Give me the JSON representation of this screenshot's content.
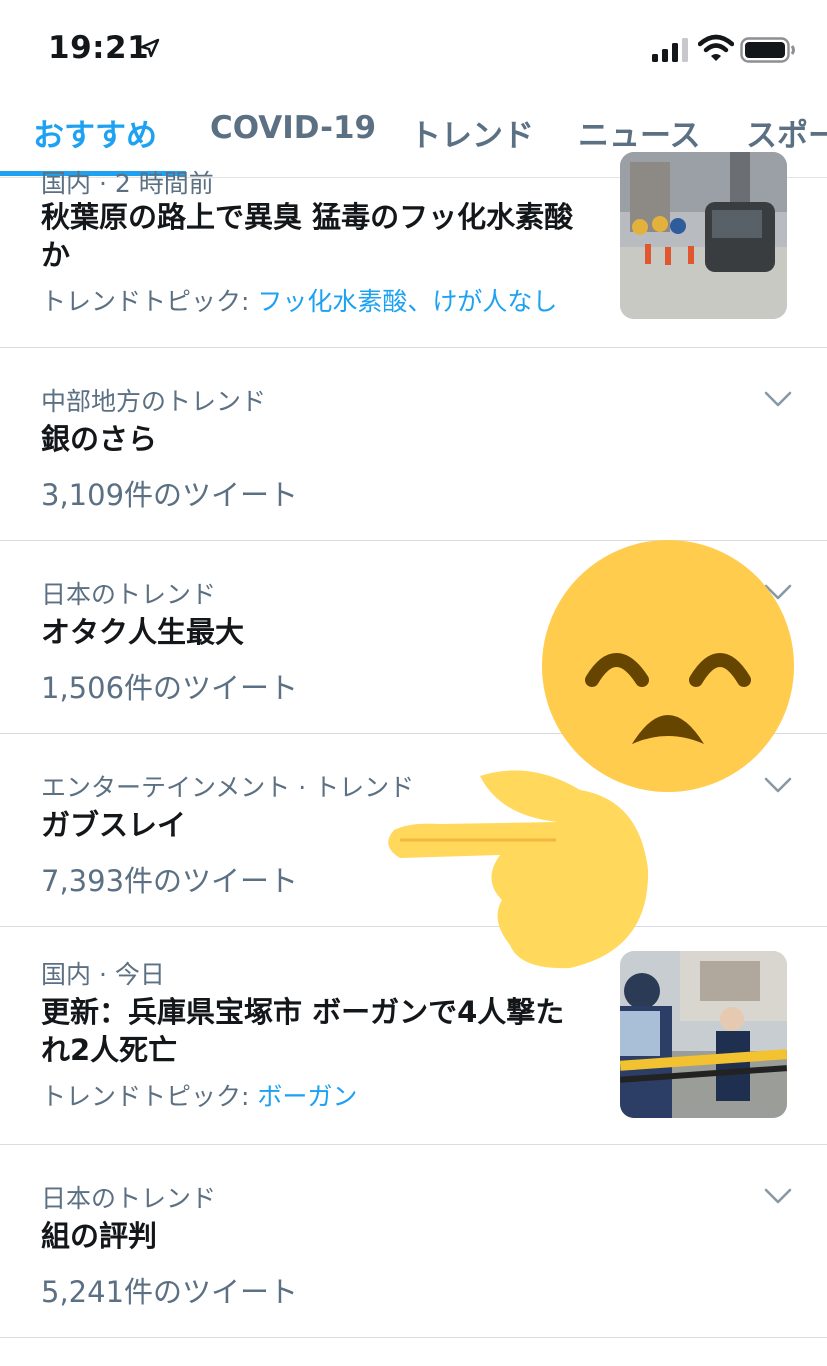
{
  "status_bar": {
    "time": "19:21",
    "icons": [
      "location-arrow-icon",
      "cellular-signal-icon",
      "wifi-icon",
      "battery-icon"
    ]
  },
  "tabs": [
    {
      "label": "おすすめ",
      "active": true
    },
    {
      "label": "COVID-19",
      "active": false
    },
    {
      "label": "トレンド",
      "active": false
    },
    {
      "label": "ニュース",
      "active": false
    },
    {
      "label": "スポー",
      "active": false
    }
  ],
  "colors": {
    "accent": "#1da1f2",
    "secondary_text": "#5b7083",
    "primary_text": "#14171a",
    "divider": "#d7dde2",
    "emoji_yellow": "#ffcc4d"
  },
  "items": [
    {
      "meta": "国内 · 2 時間前",
      "title_line1": "秋葉原の路上で異臭 猛毒のフッ化水素酸",
      "title_line2": "か",
      "topic_prefix": "トレンドトピック: ",
      "topic_links": "フッ化水素酸、けが人なし",
      "has_thumbnail": true
    },
    {
      "meta": "中部地方のトレンド",
      "title": "銀のさら",
      "count": "3,109件のツイート"
    },
    {
      "meta": "日本のトレンド",
      "title": "オタク人生最大",
      "count": "1,506件のツイート"
    },
    {
      "meta": "エンターテインメント · トレンド",
      "title": "ガブスレイ",
      "count": "7,393件のツイート"
    },
    {
      "meta": "国内 · 今日",
      "title_line1": "更新：兵庫県宝塚市 ボーガンで4人撃た",
      "title_line2": "れ2人死亡",
      "topic_prefix": "トレンドトピック: ",
      "topic_links": "ボーガン",
      "has_thumbnail": true
    },
    {
      "meta": "日本のトレンド",
      "title": "組の評判",
      "count": "5,241件のツイート"
    }
  ],
  "overlay": {
    "icons": [
      "disappointed-face-emoji",
      "pointing-left-hand-emoji"
    ]
  }
}
